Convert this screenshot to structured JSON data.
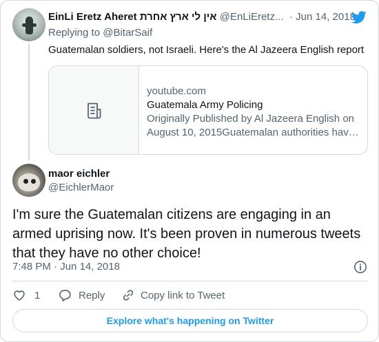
{
  "parent_tweet": {
    "display_name": "EinLi Eretz Aheret אין לי ארץ אחרת",
    "handle": "@EnLiEretz...",
    "separator": "·",
    "date": "Jun 14, 2018",
    "replying_prefix": "Replying to",
    "replying_to": "@BitarSaif",
    "text": "Guatemalan soldiers, not Israeli. Here's the Al Jazeera English report",
    "card": {
      "domain": "youtube.com",
      "title": "Guatemala Army Policing",
      "description": "Originally Published by Al Jazeera English on August 10, 2015Guatemalan authorities hav…"
    }
  },
  "main_tweet": {
    "display_name": "maor eichler",
    "handle": "@EichlerMaor",
    "text": "I'm sure the Guatemalan citizens are engaging in an armed uprising now. It's been proven in numerous tweets that they have no other choice!",
    "time": "7:48 PM",
    "separator": "·",
    "date": "Jun 14, 2018"
  },
  "actions": {
    "like_count": "1",
    "reply_label": "Reply",
    "copy_link_label": "Copy link to Tweet"
  },
  "explore_label": "Explore what's happening on Twitter",
  "icons": {
    "brand": "twitter-bird-icon",
    "card_placeholder": "document-icon",
    "info": "info-icon",
    "like": "heart-icon",
    "reply": "reply-icon",
    "copy_link": "link-icon"
  },
  "colors": {
    "brand_blue": "#1d9bf0",
    "text_primary": "#0f1419",
    "text_secondary": "#536471",
    "border": "#cfd9de"
  }
}
